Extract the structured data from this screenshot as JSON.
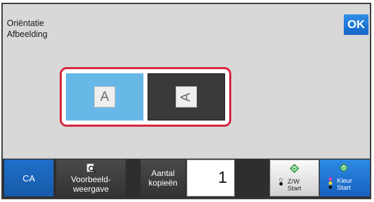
{
  "title": {
    "line1": "Oriëntatie",
    "line2": "Afbeelding"
  },
  "ok_label": "OK",
  "orientation": {
    "options": [
      {
        "glyph": "A",
        "selected": true
      },
      {
        "glyph": "A",
        "selected": false
      }
    ]
  },
  "bottom_bar": {
    "ca_label": "CA",
    "preview": {
      "line1": "Voorbeeld-",
      "line2": "weergave"
    },
    "copies": {
      "line1": "Aantal",
      "line2": "kopieën",
      "value": "1"
    },
    "start_bw": {
      "line1": "Z/W",
      "line2": "Start"
    },
    "start_color": {
      "line1": "Kleur",
      "line2": "Start"
    }
  },
  "colors": {
    "accent_blue": "#1f6fcb",
    "selected_blue": "#68b8e7",
    "highlight_red": "#d6243c",
    "start_green": "#3fb34f"
  }
}
